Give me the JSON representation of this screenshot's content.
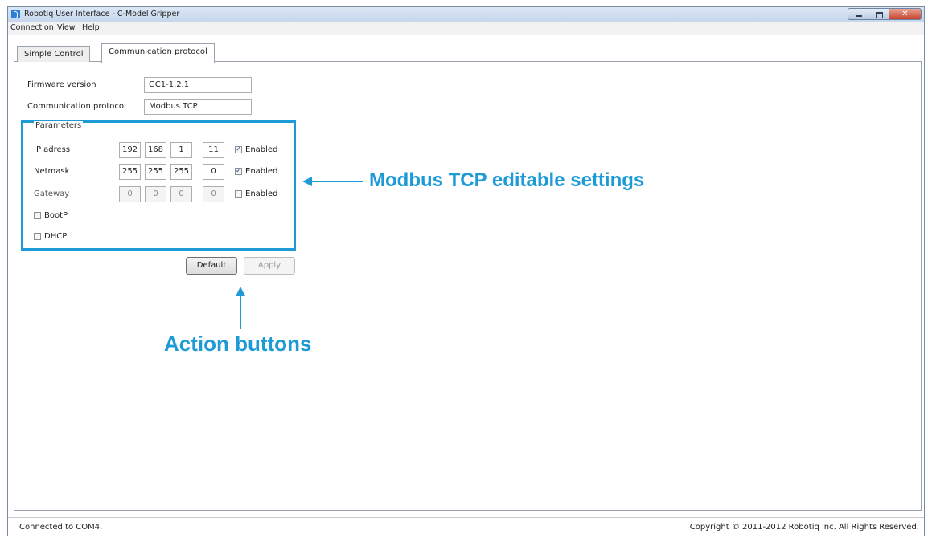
{
  "window": {
    "title": "Robotiq User Interface - C-Model Gripper"
  },
  "menu": {
    "items": [
      "Connection",
      "View",
      "Help"
    ]
  },
  "tabs": [
    {
      "label": "Simple Control",
      "active": false
    },
    {
      "label": "Communication protocol",
      "active": true
    }
  ],
  "form": {
    "firmware_label": "Firmware version",
    "firmware_value": "GC1-1.2.1",
    "protocol_label": "Communication protocol",
    "protocol_value": "Modbus TCP"
  },
  "parameters": {
    "title": "Parameters",
    "ip": {
      "label": "IP adress",
      "octets": [
        "192",
        "168",
        "1",
        "11"
      ],
      "enabled_label": "Enabled",
      "enabled": true
    },
    "netmask": {
      "label": "Netmask",
      "octets": [
        "255",
        "255",
        "255",
        "0"
      ],
      "enabled_label": "Enabled",
      "enabled": true
    },
    "gateway": {
      "label": "Gateway",
      "octets": [
        "0",
        "0",
        "0",
        "0"
      ],
      "enabled_label": "Enabled",
      "enabled": false
    },
    "bootp": {
      "label": "BootP",
      "checked": false
    },
    "dhcp": {
      "label": "DHCP",
      "checked": false
    }
  },
  "buttons": {
    "default_label": "Default",
    "apply_label": "Apply"
  },
  "annotations": {
    "settings": "Modbus TCP editable settings",
    "actions": "Action buttons",
    "accent_color": "#1e9bd7"
  },
  "status": {
    "left": "Connected to COM4.",
    "right": "Copyright © 2011-2012 Robotiq inc. All Rights Reserved."
  }
}
